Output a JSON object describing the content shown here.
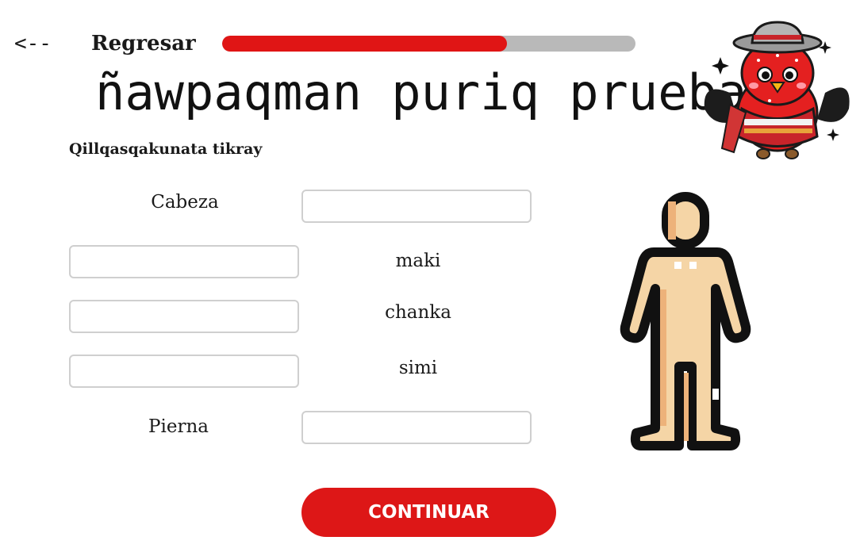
{
  "header": {
    "back_arrow": "<--",
    "back_label": "Regresar",
    "progress_percent": 69
  },
  "title": "ñawpaqman puriq prueba",
  "instruction": "Qillqasqakunata tikray",
  "rows": [
    {
      "word": "Cabeza",
      "input_value": ""
    },
    {
      "word": "maki",
      "input_value": ""
    },
    {
      "word": "chanka",
      "input_value": ""
    },
    {
      "word": "simi",
      "input_value": ""
    },
    {
      "word": "Pierna",
      "input_value": ""
    }
  ],
  "continue_label": "CONTINUAR",
  "colors": {
    "accent": "#dd1717",
    "progress_track": "#b9b9b9",
    "body_fill": "#f5d5a6",
    "outline": "#111111"
  },
  "icons": {
    "mascot": "red-bird-mascot-icon",
    "body": "human-body-icon"
  }
}
